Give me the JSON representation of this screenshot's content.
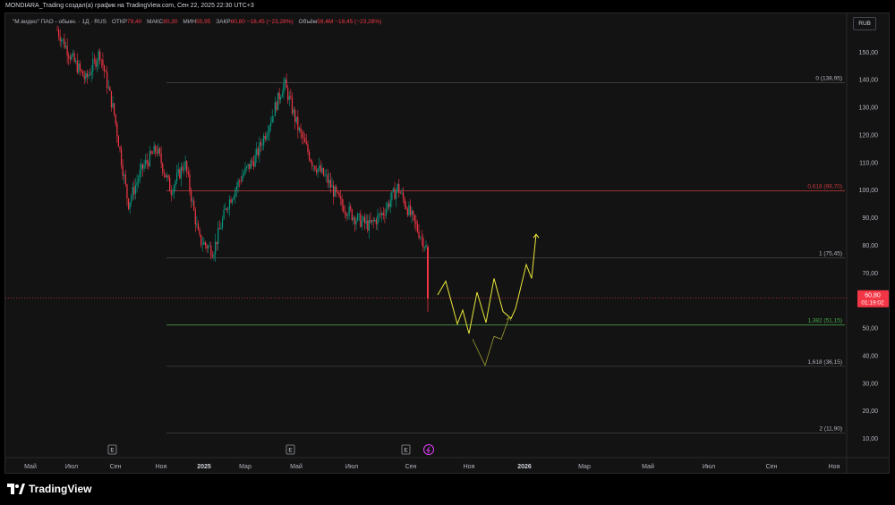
{
  "header": {
    "attribution": "MONDIARA_Trading создал(а) график на TradingView.com, Сен 22, 2025 22:30 UTC+3"
  },
  "legend": {
    "symbol": "\"М.видео\" ПАО - обыкн. · 1Д · RUS",
    "open_label": "ОТКР",
    "open_value": "79,40",
    "high_label": "МАКС",
    "high_value": "80,30",
    "low_label": "МИН",
    "low_value": "55,95",
    "close_label": "ЗАКР",
    "close_value": "60,80",
    "change": "−18,45 (−23,28%)",
    "volume_label": "Объём",
    "volume_value": "59,4M",
    "volume_change": "−18,45 (−23,28%)"
  },
  "currency": "RUB",
  "price_tag": {
    "value": "60,80",
    "countdown": "01:19:02"
  },
  "brand": "TradingView",
  "colors": {
    "up": "#089981",
    "down": "#f23645",
    "projection": "#e8e63a",
    "fib_line": "#4a4a4a",
    "fib_618": "#c43a3a",
    "fib_1382": "#4caf50"
  },
  "chart_data": {
    "type": "candlestick",
    "ylim": [
      10,
      165
    ],
    "yticks": [
      "10,00",
      "20,00",
      "30,00",
      "40,00",
      "50,00",
      "60,00",
      "70,00",
      "80,00",
      "90,00",
      "100,00",
      "110,00",
      "120,00",
      "130,00",
      "140,00",
      "150,00"
    ],
    "xticks": [
      "Май",
      "Июл",
      "Сен",
      "Ноя",
      "2025",
      "Мар",
      "Май",
      "Июл",
      "Сен",
      "Ноя",
      "2026",
      "Мар",
      "Май",
      "Июл",
      "Сен",
      "Ноя"
    ],
    "earnings_markers": [
      "E",
      "E",
      "E"
    ],
    "fib_levels": [
      {
        "ratio": "0",
        "price": 138.95,
        "label": "0 (138,95)"
      },
      {
        "ratio": "0.618",
        "price": 99.7,
        "label": "0,618 (99,70)"
      },
      {
        "ratio": "1",
        "price": 75.45,
        "label": "1 (75,45)"
      },
      {
        "ratio": "1.382",
        "price": 51.15,
        "label": "1,382 (51,15)"
      },
      {
        "ratio": "1.618",
        "price": 36.15,
        "label": "1,618 (36,15)"
      },
      {
        "ratio": "2",
        "price": 11.9,
        "label": "2 (11,90)"
      }
    ],
    "price_path": [
      [
        "Май",
        158
      ],
      [
        "Июн",
        148
      ],
      [
        "Июл",
        140
      ],
      [
        "Авг",
        150
      ],
      [
        "Авг",
        128
      ],
      [
        "Сен",
        95
      ],
      [
        "Сен",
        108
      ],
      [
        "Окт",
        115
      ],
      [
        "Окт",
        100
      ],
      [
        "Ноя",
        110
      ],
      [
        "Ноя",
        82
      ],
      [
        "Дек",
        78
      ],
      [
        "Дек",
        95
      ],
      [
        "Янв",
        105
      ],
      [
        "Фев",
        112
      ],
      [
        "Мар",
        125
      ],
      [
        "Мар",
        139
      ],
      [
        "Апр",
        122
      ],
      [
        "Май",
        110
      ],
      [
        "Май",
        104
      ],
      [
        "Июн",
        95
      ],
      [
        "Июл",
        90
      ],
      [
        "Июл",
        87
      ],
      [
        "Авг",
        92
      ],
      [
        "Авг",
        101
      ],
      [
        "Сен",
        90
      ],
      [
        "Сен",
        79.4
      ],
      [
        "Сен",
        60.8
      ]
    ],
    "projection_primary": [
      62,
      67,
      51.5,
      56.5,
      48,
      63,
      52,
      68,
      56,
      53.5,
      57,
      73,
      68,
      84
    ],
    "projection_secondary": [
      46,
      36.5,
      47,
      46,
      54
    ]
  }
}
